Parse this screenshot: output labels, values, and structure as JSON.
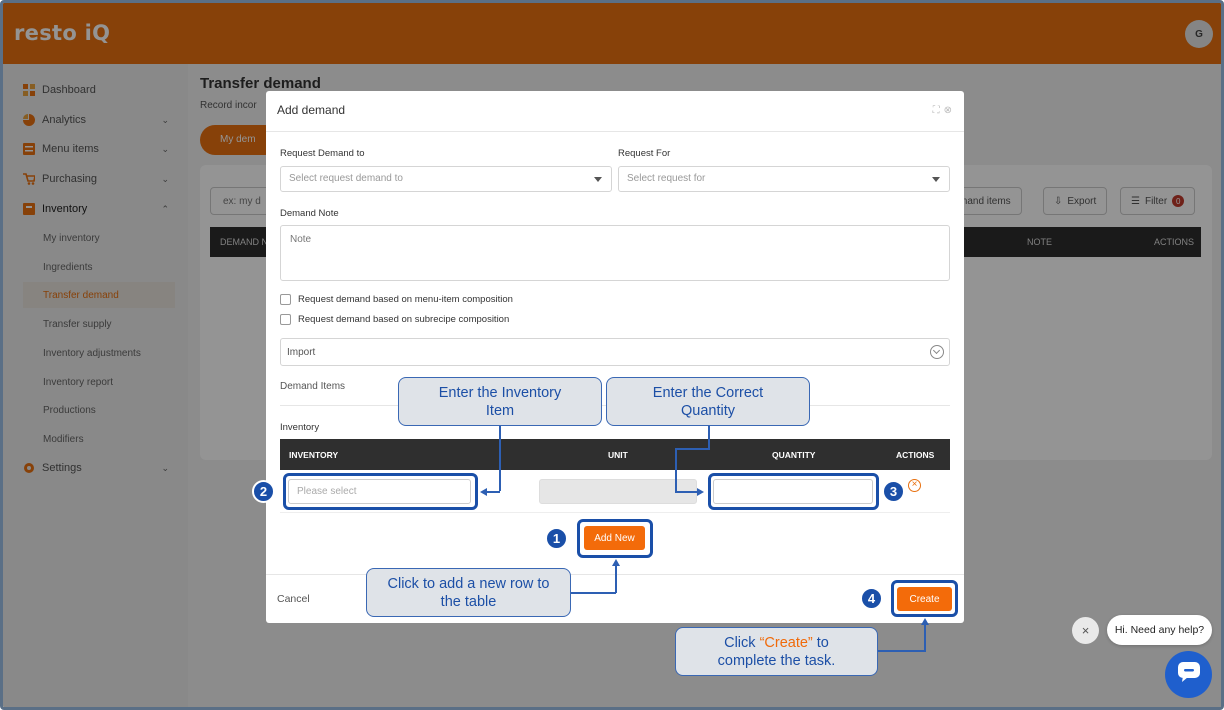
{
  "app": {
    "brand": "resto iQ",
    "avatar_initial": "G",
    "accent": "#e87110",
    "annotation_color": "#1a4fa8"
  },
  "sidebar": {
    "items": [
      {
        "label": "Dashboard",
        "icon": "dashboard-icon"
      },
      {
        "label": "Analytics",
        "icon": "analytics-icon"
      },
      {
        "label": "Menu items",
        "icon": "menu-icon"
      },
      {
        "label": "Purchasing",
        "icon": "cart-icon"
      },
      {
        "label": "Inventory",
        "icon": "inventory-icon"
      },
      {
        "label": "Settings",
        "icon": "gear-icon"
      }
    ],
    "inventory_sub": [
      "My inventory",
      "Ingredients",
      "Transfer demand",
      "Transfer supply",
      "Inventory adjustments",
      "Inventory report",
      "Productions",
      "Modifiers"
    ]
  },
  "main": {
    "title": "Transfer demand",
    "subtitle": "Record incor",
    "pill": "My dem",
    "search_placeholder": "ex: my d",
    "toolbar": {
      "demand_items": "mand items",
      "export": "Export",
      "filter": "Filter",
      "filter_count": "0"
    },
    "columns": {
      "first": "DEMAND N",
      "note": "NOTE",
      "actions": "ACTIONS"
    }
  },
  "modal": {
    "title": "Add demand",
    "request_to_label": "Request Demand to",
    "request_to_placeholder": "Select request demand to",
    "request_for_label": "Request For",
    "request_for_placeholder": "Select request for",
    "note_label": "Demand Note",
    "note_placeholder": "Note",
    "check_menu": "Request demand based on menu-item composition",
    "check_subrecipe": "Request demand based on subrecipe composition",
    "import": "Import",
    "demand_items": "Demand Items",
    "inventory_label": "Inventory",
    "table": {
      "col_inventory": "INVENTORY",
      "col_unit": "UNIT",
      "col_quantity": "QUANTITY",
      "col_actions": "ACTIONS"
    },
    "row": {
      "inventory_placeholder": "Please select"
    },
    "add_new": "Add New",
    "cancel": "Cancel",
    "create": "Create"
  },
  "annotations": {
    "callout_inventory": "Enter the Inventory Item",
    "callout_quantity": "Enter the Correct Quantity",
    "callout_add_row": "Click to add a new row to the table",
    "callout_create_pre": "Click ",
    "callout_create_quoted": "“Create”",
    "callout_create_post": " to",
    "callout_create_line2": "complete the task.",
    "step1": "1",
    "step2": "2",
    "step3": "3",
    "step4": "4"
  },
  "chat": {
    "bubble": "Hi. Need any help?",
    "close": "×"
  }
}
